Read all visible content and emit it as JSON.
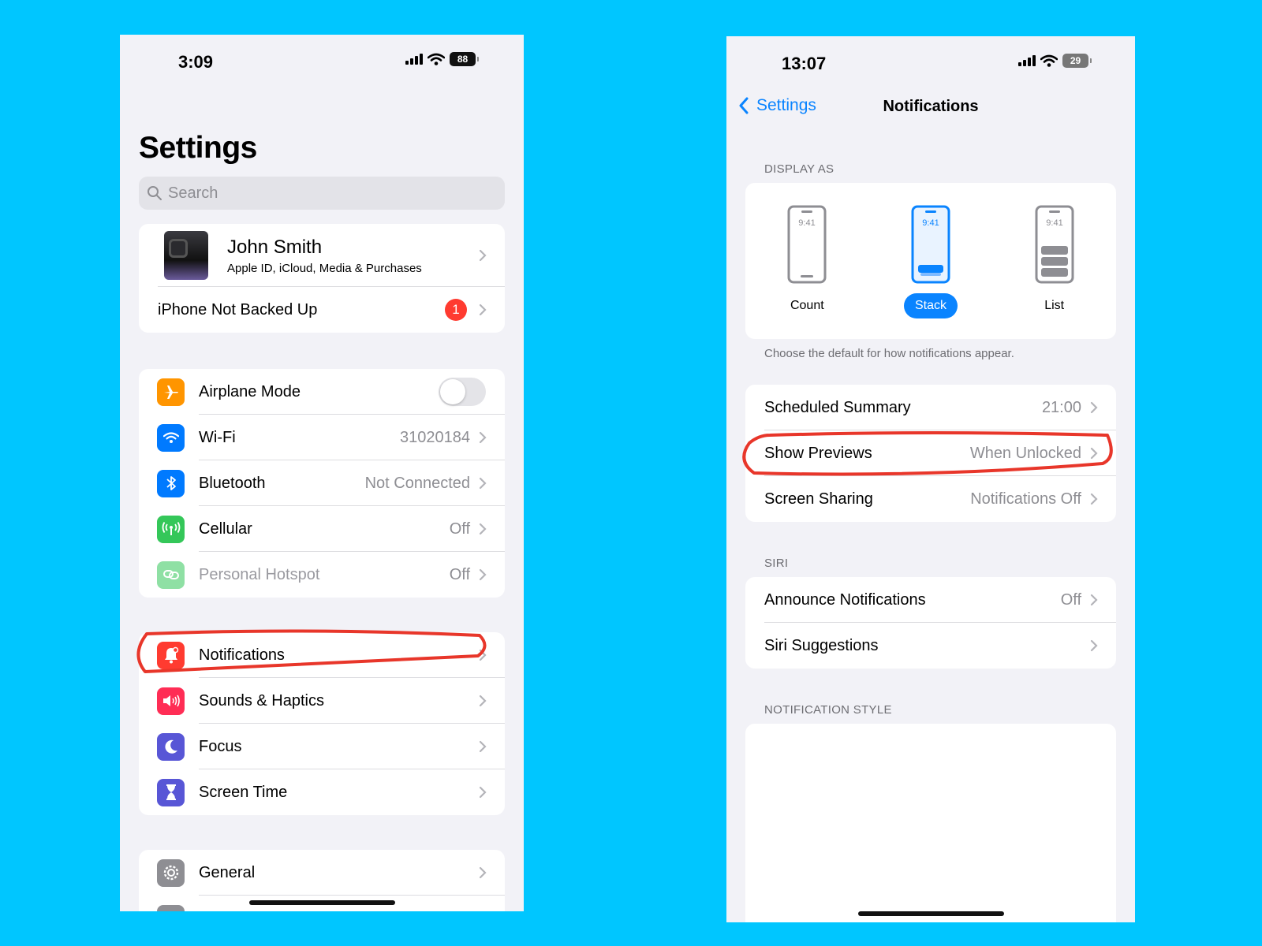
{
  "left_phone": {
    "status": {
      "time": "3:09",
      "battery": "88"
    },
    "title": "Settings",
    "search": {
      "placeholder": "Search"
    },
    "account": {
      "name": "John Smith",
      "subtitle": "Apple ID, iCloud, Media & Purchases"
    },
    "backup": {
      "label": "iPhone Not Backed Up",
      "badge": "1"
    },
    "connectivity": [
      {
        "label": "Airplane Mode",
        "icon": "airplane-icon",
        "color": "#ff9500"
      },
      {
        "label": "Wi-Fi",
        "value": "31020184",
        "icon": "wifi-icon",
        "color": "#007aff"
      },
      {
        "label": "Bluetooth",
        "value": "Not Connected",
        "icon": "bluetooth-icon",
        "color": "#007aff"
      },
      {
        "label": "Cellular",
        "value": "Off",
        "icon": "antenna-icon",
        "color": "#34c759"
      },
      {
        "label": "Personal Hotspot",
        "value": "Off",
        "icon": "hotspot-icon",
        "color": "#34c759"
      }
    ],
    "alerts": [
      {
        "label": "Notifications",
        "icon": "bell-icon",
        "color": "#ff3b30"
      },
      {
        "label": "Sounds & Haptics",
        "icon": "speaker-icon",
        "color": "#ff2d55"
      },
      {
        "label": "Focus",
        "icon": "moon-icon",
        "color": "#5856d6"
      },
      {
        "label": "Screen Time",
        "icon": "hourglass-icon",
        "color": "#5856d6"
      }
    ],
    "general": [
      {
        "label": "General",
        "icon": "gear-icon",
        "color": "#8e8e93"
      }
    ]
  },
  "right_phone": {
    "status": {
      "time": "13:07",
      "battery": "29"
    },
    "nav": {
      "back_label": "Settings",
      "title": "Notifications"
    },
    "display_as": {
      "header": "DISPLAY AS",
      "options": [
        {
          "label": "Count",
          "screen_time": "9:41"
        },
        {
          "label": "Stack",
          "screen_time": "9:41"
        },
        {
          "label": "List",
          "screen_time": "9:41"
        }
      ],
      "selected": "Stack",
      "footer": "Choose the default for how notifications appear."
    },
    "options": [
      {
        "label": "Scheduled Summary",
        "value": "21:00"
      },
      {
        "label": "Show Previews",
        "value": "When Unlocked"
      },
      {
        "label": "Screen Sharing",
        "value": "Notifications Off"
      }
    ],
    "siri": {
      "header": "SIRI",
      "rows": [
        {
          "label": "Announce Notifications",
          "value": "Off"
        },
        {
          "label": "Siri Suggestions",
          "value": ""
        }
      ]
    },
    "style_header": "NOTIFICATION STYLE"
  },
  "annotation_color": "#e8362a"
}
